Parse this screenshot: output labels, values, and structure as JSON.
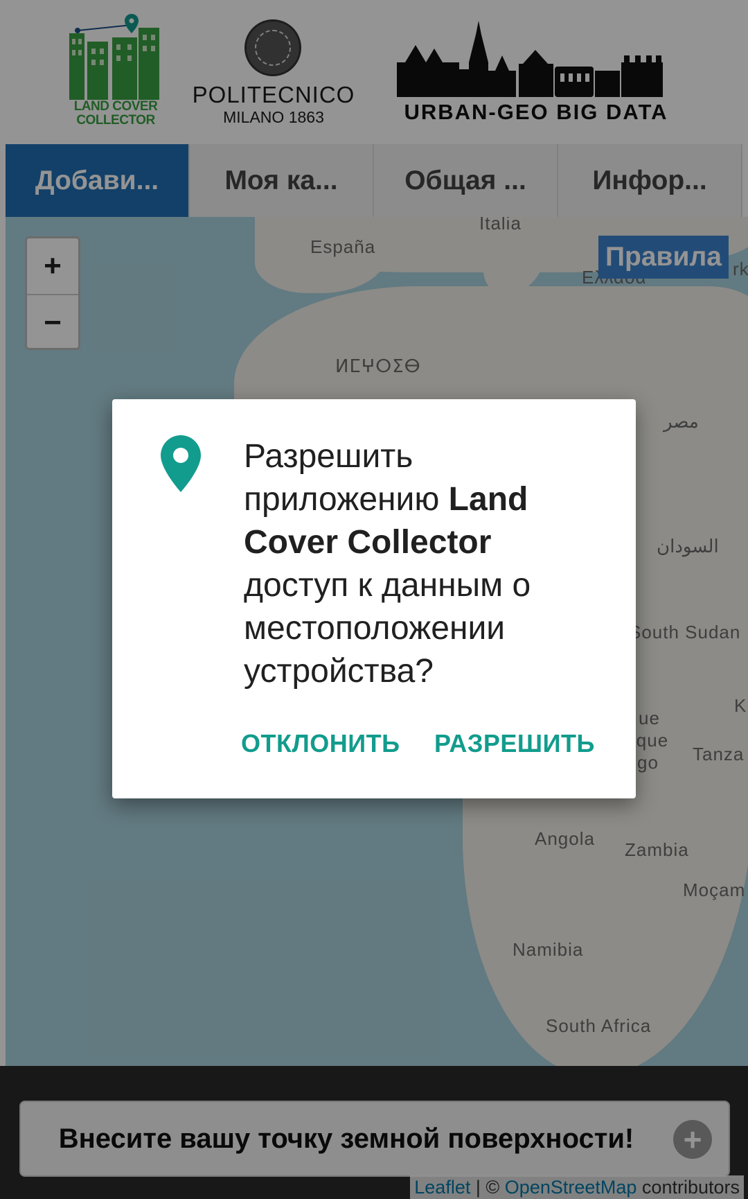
{
  "header": {
    "lcc_logo_text": "LAND COVER COLLECTOR",
    "poli_name": "POLITECNICO",
    "poli_sub": "MILANO 1863",
    "urban_text": "URBAN-GEO BIG DATA"
  },
  "tabs": [
    {
      "label": "Добави..."
    },
    {
      "label": "Моя ка..."
    },
    {
      "label": "Общая ..."
    },
    {
      "label": "Инфор..."
    }
  ],
  "map": {
    "zoom_in": "+",
    "zoom_out": "−",
    "rules_button": "Правила",
    "labels": {
      "italia": "Italia",
      "espana": "España",
      "ellada": "Ελλάδα",
      "morocco": "ⵍⵎⵖⵔⵉⴱ",
      "egypt": "مصر",
      "sudan": "السودان",
      "south_sudan": "South Sudan",
      "congo_a": "ue",
      "congo_b": "ique",
      "congo_c": "go",
      "tanzania": "Tanza",
      "angola": "Angola",
      "zambia": "Zambia",
      "mozambique": "Moçam",
      "namibia": "Namibia",
      "south_africa": "South Africa",
      "k_label": "K",
      "rk_label": "rk"
    }
  },
  "bottom": {
    "add_point": "Внесите вашу точку земной поверхности!",
    "plus": "+"
  },
  "attribution": {
    "leaflet": "Leaflet",
    "sep": "| ©",
    "osm": "OpenStreetMap",
    "contrib": "contributors"
  },
  "dialog": {
    "line1": "Разрешить приложению ",
    "app_name": "Land Cover Collector",
    "line2": " доступ к данным о местоположении устройства?",
    "deny": "ОТКЛОНИТЬ",
    "allow": "РАЗРЕШИТЬ"
  },
  "colors": {
    "tab_active": "#1f6fb6",
    "accent": "#129c8d",
    "map_water": "#aad3df",
    "map_land": "#f2efe9"
  }
}
